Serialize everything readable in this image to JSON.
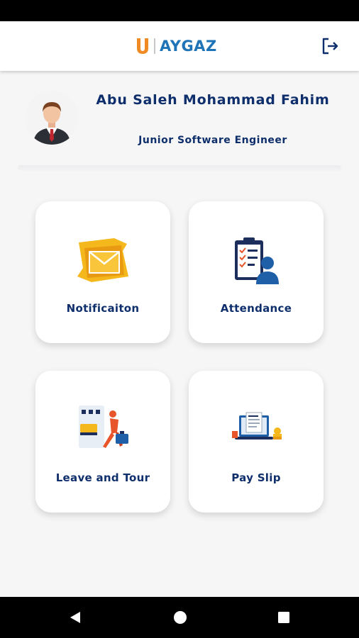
{
  "header": {
    "brand": "AYGAZ",
    "logout_icon": "logout-icon"
  },
  "profile": {
    "name": "Abu Saleh Mohammad Fahim",
    "designation": "Junior Software Engineer"
  },
  "menu": [
    {
      "label": "Notificaiton",
      "icon": "envelope-icon"
    },
    {
      "label": "Attendance",
      "icon": "clipboard-person-icon"
    },
    {
      "label": "Leave and Tour",
      "icon": "traveler-luggage-icon"
    },
    {
      "label": "Pay Slip",
      "icon": "laptop-salary-icon"
    }
  ],
  "colors": {
    "primary_text": "#0e2f6b",
    "brand_blue": "#1f73b7",
    "brand_orange": "#f08a24"
  },
  "system_nav": {
    "back": "back-triangle-icon",
    "home": "home-circle-icon",
    "recents": "recents-square-icon"
  }
}
